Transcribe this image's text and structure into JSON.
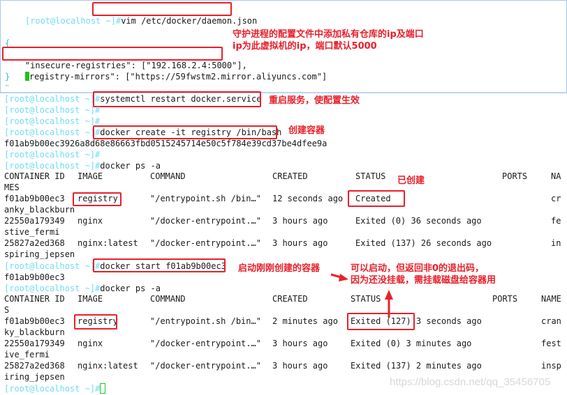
{
  "prompt": "[root@localhost ~]#",
  "vim_panel": {
    "command": "vim /etc/docker/daemon.json",
    "open_brace": "{",
    "insecure_line": "\"insecure-registries\": [\"192.168.2.4:5000\"],",
    "mirrors_key": "\"registry-mirrors\": ",
    "mirrors_value": "[\"https://59fwstm2.mirror.aliyuncs.com\"]",
    "mirrors_first_char": "\"",
    "mirrors_rest": "registry-mirrors\": ",
    "close_brace": "}",
    "tilde": "~",
    "note": "守护进程的配置文件中添加私有仓库的ip及端口\nip为此虚拟机的ip，端口默认5000"
  },
  "terminal": {
    "restart_cmd": "systemctl restart docker.service",
    "restart_note": "重启服务，使配置生效",
    "create_cmd": "docker create -it registry /bin/bash",
    "create_note": "创建容器",
    "create_output": "f01ab9b00ec3926a8d68e86663fbd0515245714e50c5f784e39cd37be4dfee9a",
    "ps_cmd": "docker ps -a",
    "start_cmd": "docker start f01ab9b00ec3",
    "start_note": "启动刚刚创建的容器",
    "start_output": "f01ab9b00ec3",
    "created_note": "已创建",
    "exit_note": "可以启动，但返回非0的退出码，\n因为还没挂载，需挂载磁盘给容器用"
  },
  "ps1": {
    "headers": {
      "id": "CONTAINER ID",
      "image": "IMAGE",
      "command": "COMMAND",
      "created": "CREATED",
      "status": "STATUS",
      "ports": "PORTS",
      "names": "NA"
    },
    "header_wrap": "MES",
    "rows": [
      {
        "id": "f01ab9b00ec3",
        "image": "registry",
        "command": "\"/entrypoint.sh /bin…\"",
        "created": "12 seconds ago",
        "status": "Created",
        "ports": "",
        "names": "cr",
        "wrap": "anky_blackburn"
      },
      {
        "id": "22550a179349",
        "image": "nginx",
        "command": "\"/docker-entrypoint.…\"",
        "created": "3 hours ago",
        "status": "Exited (0) 36 seconds ago",
        "ports": "",
        "names": "fe",
        "wrap": "stive_fermi"
      },
      {
        "id": "25827a2ed368",
        "image": "nginx:latest",
        "command": "\"/docker-entrypoint.…\"",
        "created": "3 hours ago",
        "status": "Exited (137) 26 seconds ago",
        "ports": "",
        "names": "in",
        "wrap": "spiring_jepsen"
      }
    ]
  },
  "ps2": {
    "headers": {
      "id": "CONTAINER ID",
      "image": "IMAGE",
      "command": "COMMAND",
      "created": "CREATED",
      "status": "STATUS",
      "ports": "PORTS",
      "names": "NAME"
    },
    "header_wrap": "S",
    "rows": [
      {
        "id": "f01ab9b00ec3",
        "image": "registry",
        "command": "\"/entrypoint.sh /bin…\"",
        "created": "2 minutes ago",
        "status": "Exited (127) 3 seconds ago",
        "ports": "",
        "names": "cran",
        "wrap": "ky_blackburn"
      },
      {
        "id": "22550a179349",
        "image": "nginx",
        "command": "\"/docker-entrypoint.…\"",
        "created": "3 hours ago",
        "status": "Exited (0) 3 minutes ago",
        "ports": "",
        "names": "fest",
        "wrap": "ive_fermi"
      },
      {
        "id": "25827a2ed368",
        "image": "nginx:latest",
        "command": "\"/docker-entrypoint.…\"",
        "created": "3 hours ago",
        "status": "Exited (137) 2 minutes ago",
        "ports": "",
        "names": "insp",
        "wrap": "iring_jepsen"
      }
    ]
  },
  "watermark": "https://blog.csdn.net/qq_35456705",
  "colors": {
    "prompt": "#6fdcf3",
    "annotation": "#e8202a",
    "cursor": "#19c619"
  }
}
